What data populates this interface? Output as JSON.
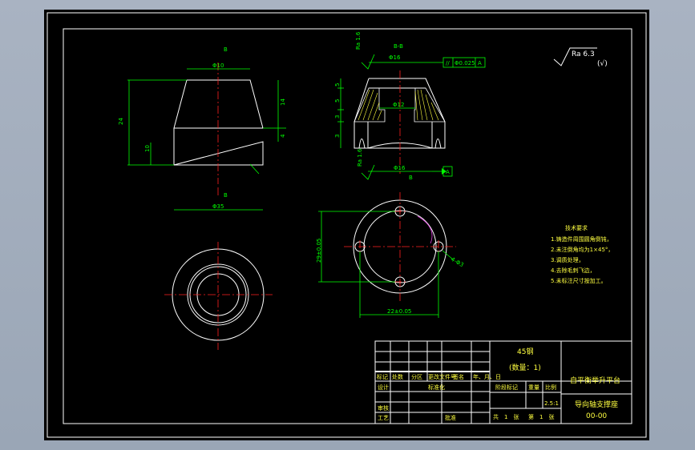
{
  "section_label": "B-B",
  "roughness_label": "Ra 6.3",
  "roughness_symbol": "(√)",
  "front_view": {
    "dia_top": "Φ10",
    "dia_bottom": "Φ35",
    "height_total": "24",
    "height_upper": "14",
    "height_lower": "10",
    "height_small": "4",
    "section_mark_a": "B",
    "section_mark_b": "B"
  },
  "section_view": {
    "dia_top": "Φ16",
    "dia_mid": "Φ12",
    "dia_bottom": "Φ16",
    "roughness_top": "Ra 1.6",
    "roughness_bottom": "Ra 1.6",
    "tolerance_frame": [
      "//",
      "Φ0.025",
      "A"
    ],
    "datum": "A",
    "dims_left": [
      "5",
      "5",
      "3",
      "3"
    ],
    "bottom_mark": "B"
  },
  "bottom_view": {
    "dim_vertical": "29±0.05",
    "dim_horizontal": "22±0.05",
    "hole_note": "4-Φ3"
  },
  "tech_requirements": {
    "title": "技术要求",
    "items": [
      "1.铸造件周围圆角倒钝，",
      "2.未注倒角均为1×45°，",
      "3.调质处理，",
      "4.去除毛刺飞边，",
      "5.未标注尺寸按加工。"
    ]
  },
  "title_block": {
    "material": "45钢",
    "quantity": "(数量：1)",
    "company": "自平衡举升平台",
    "part_name": "导向轴支撑座",
    "drawing_no": "00-00",
    "scale": "2.5:1",
    "header_cells": [
      "标记",
      "处数",
      "分区",
      "更改文件号",
      "签名",
      "年、月、日"
    ],
    "row_labels": [
      "设计",
      "审核",
      "工艺"
    ],
    "std_label": "标准化",
    "approve_label": "批准",
    "stage_label": "阶段标记",
    "weight_label": "重量",
    "scale_label": "比例",
    "sheet_total": "共　1　张",
    "sheet_no": "第　1　张"
  }
}
